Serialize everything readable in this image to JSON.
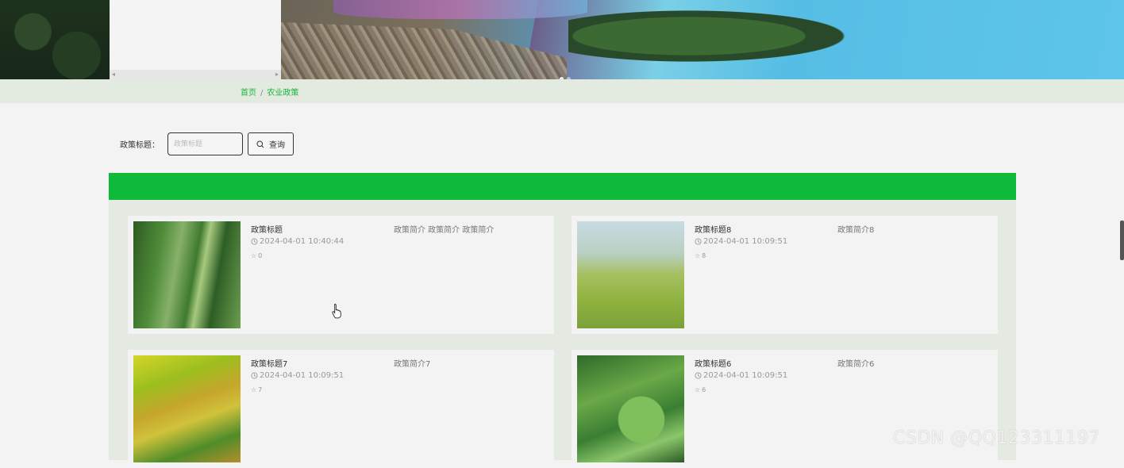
{
  "breadcrumb": {
    "home": "首页",
    "separator": "/",
    "current": "农业政策"
  },
  "search": {
    "label": "政策标题：",
    "placeholder": "政策标题",
    "value": "",
    "button_label": "查询"
  },
  "cards": [
    {
      "title": "政策标题",
      "summary": "政策简介 政策简介 政策简介",
      "time": "2024-04-01 10:40:44",
      "likes": "0",
      "image": "corn-plant"
    },
    {
      "title": "政策标题8",
      "summary": "政策简介8",
      "time": "2024-04-01 10:09:51",
      "likes": "8",
      "image": "wheat-ears"
    },
    {
      "title": "政策标题7",
      "summary": "政策简介7",
      "time": "2024-04-01 10:09:51",
      "likes": "7",
      "image": "rice-field"
    },
    {
      "title": "政策标题6",
      "summary": "政策简介6",
      "time": "2024-04-01 10:09:51",
      "likes": "6",
      "image": "pea-pods"
    }
  ],
  "watermark": "CSDN @QQ123311197",
  "colors": {
    "accent": "#0fb93a",
    "breadcrumb_bg": "#e3ebe1",
    "content_bg": "#e4eae2"
  }
}
